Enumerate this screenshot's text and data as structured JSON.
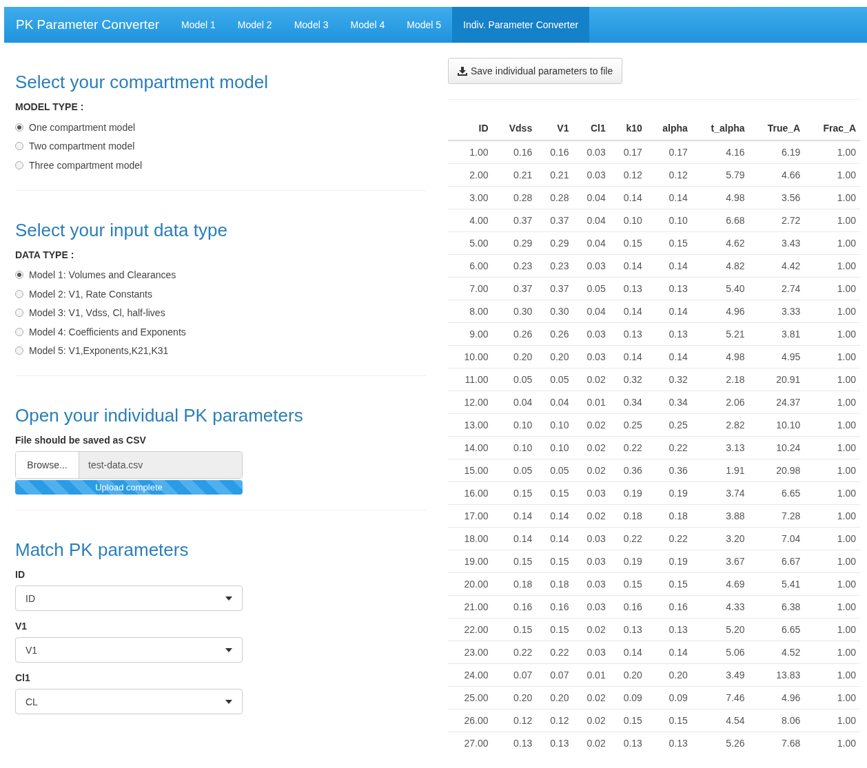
{
  "navbar": {
    "brand": "PK Parameter Converter",
    "tabs": [
      {
        "label": "Model 1",
        "selected": false
      },
      {
        "label": "Model 2",
        "selected": false
      },
      {
        "label": "Model 3",
        "selected": false
      },
      {
        "label": "Model 4",
        "selected": false
      },
      {
        "label": "Model 5",
        "selected": false
      },
      {
        "label": "Indiv. Parameter Converter",
        "selected": true
      }
    ]
  },
  "sections": [
    {
      "kind": "radio",
      "title": "Select your compartment model",
      "label": "MODEL TYPE :",
      "options": [
        {
          "label": "One compartment model",
          "selected": true
        },
        {
          "label": "Two compartment model",
          "selected": false
        },
        {
          "label": "Three compartment model",
          "selected": false
        }
      ]
    },
    {
      "kind": "radio",
      "title": "Select your input data type",
      "label": "DATA TYPE :",
      "options": [
        {
          "label": "Model 1: Volumes and Clearances",
          "selected": true
        },
        {
          "label": "Model 2: V1, Rate Constants",
          "selected": false
        },
        {
          "label": "Model 3: V1, Vdss, Cl, half-lives",
          "selected": false
        },
        {
          "label": "Model 4: Coefficients and Exponents",
          "selected": false
        },
        {
          "label": "Model 5: V1,Exponents,K21,K31",
          "selected": false
        }
      ]
    },
    {
      "kind": "file",
      "title": "Open your individual PK parameters",
      "label": "File should be saved as CSV",
      "browse": "Browse...",
      "value": "test-data.csv",
      "progress": {
        "level": 1,
        "text": "Upload complete"
      }
    },
    {
      "kind": "selects",
      "title": "Match PK parameters",
      "selects": [
        {
          "label": "ID",
          "value": "ID"
        },
        {
          "label": "V1",
          "value": "V1"
        },
        {
          "label": "Cl1",
          "value": "CL"
        }
      ]
    }
  ],
  "save_button": "Save individual parameters to file",
  "table": {
    "columns": [
      "ID",
      "Vdss",
      "V1",
      "Cl1",
      "k10",
      "alpha",
      "t_alpha",
      "True_A",
      "Frac_A"
    ],
    "rows": [
      [
        "1.00",
        "0.16",
        "0.16",
        "0.03",
        "0.17",
        "0.17",
        "4.16",
        "6.19",
        "1.00"
      ],
      [
        "2.00",
        "0.21",
        "0.21",
        "0.03",
        "0.12",
        "0.12",
        "5.79",
        "4.66",
        "1.00"
      ],
      [
        "3.00",
        "0.28",
        "0.28",
        "0.04",
        "0.14",
        "0.14",
        "4.98",
        "3.56",
        "1.00"
      ],
      [
        "4.00",
        "0.37",
        "0.37",
        "0.04",
        "0.10",
        "0.10",
        "6.68",
        "2.72",
        "1.00"
      ],
      [
        "5.00",
        "0.29",
        "0.29",
        "0.04",
        "0.15",
        "0.15",
        "4.62",
        "3.43",
        "1.00"
      ],
      [
        "6.00",
        "0.23",
        "0.23",
        "0.03",
        "0.14",
        "0.14",
        "4.82",
        "4.42",
        "1.00"
      ],
      [
        "7.00",
        "0.37",
        "0.37",
        "0.05",
        "0.13",
        "0.13",
        "5.40",
        "2.74",
        "1.00"
      ],
      [
        "8.00",
        "0.30",
        "0.30",
        "0.04",
        "0.14",
        "0.14",
        "4.96",
        "3.33",
        "1.00"
      ],
      [
        "9.00",
        "0.26",
        "0.26",
        "0.03",
        "0.13",
        "0.13",
        "5.21",
        "3.81",
        "1.00"
      ],
      [
        "10.00",
        "0.20",
        "0.20",
        "0.03",
        "0.14",
        "0.14",
        "4.98",
        "4.95",
        "1.00"
      ],
      [
        "11.00",
        "0.05",
        "0.05",
        "0.02",
        "0.32",
        "0.32",
        "2.18",
        "20.91",
        "1.00"
      ],
      [
        "12.00",
        "0.04",
        "0.04",
        "0.01",
        "0.34",
        "0.34",
        "2.06",
        "24.37",
        "1.00"
      ],
      [
        "13.00",
        "0.10",
        "0.10",
        "0.02",
        "0.25",
        "0.25",
        "2.82",
        "10.10",
        "1.00"
      ],
      [
        "14.00",
        "0.10",
        "0.10",
        "0.02",
        "0.22",
        "0.22",
        "3.13",
        "10.24",
        "1.00"
      ],
      [
        "15.00",
        "0.05",
        "0.05",
        "0.02",
        "0.36",
        "0.36",
        "1.91",
        "20.98",
        "1.00"
      ],
      [
        "16.00",
        "0.15",
        "0.15",
        "0.03",
        "0.19",
        "0.19",
        "3.74",
        "6.65",
        "1.00"
      ],
      [
        "17.00",
        "0.14",
        "0.14",
        "0.02",
        "0.18",
        "0.18",
        "3.88",
        "7.28",
        "1.00"
      ],
      [
        "18.00",
        "0.14",
        "0.14",
        "0.03",
        "0.22",
        "0.22",
        "3.20",
        "7.04",
        "1.00"
      ],
      [
        "19.00",
        "0.15",
        "0.15",
        "0.03",
        "0.19",
        "0.19",
        "3.67",
        "6.67",
        "1.00"
      ],
      [
        "20.00",
        "0.18",
        "0.18",
        "0.03",
        "0.15",
        "0.15",
        "4.69",
        "5.41",
        "1.00"
      ],
      [
        "21.00",
        "0.16",
        "0.16",
        "0.03",
        "0.16",
        "0.16",
        "4.33",
        "6.38",
        "1.00"
      ],
      [
        "22.00",
        "0.15",
        "0.15",
        "0.02",
        "0.13",
        "0.13",
        "5.20",
        "6.65",
        "1.00"
      ],
      [
        "23.00",
        "0.22",
        "0.22",
        "0.03",
        "0.14",
        "0.14",
        "5.06",
        "4.52",
        "1.00"
      ],
      [
        "24.00",
        "0.07",
        "0.07",
        "0.01",
        "0.20",
        "0.20",
        "3.49",
        "13.83",
        "1.00"
      ],
      [
        "25.00",
        "0.20",
        "0.20",
        "0.02",
        "0.09",
        "0.09",
        "7.46",
        "4.96",
        "1.00"
      ],
      [
        "26.00",
        "0.12",
        "0.12",
        "0.02",
        "0.15",
        "0.15",
        "4.54",
        "8.06",
        "1.00"
      ],
      [
        "27.00",
        "0.13",
        "0.13",
        "0.02",
        "0.13",
        "0.13",
        "5.26",
        "7.68",
        "1.00"
      ]
    ]
  }
}
